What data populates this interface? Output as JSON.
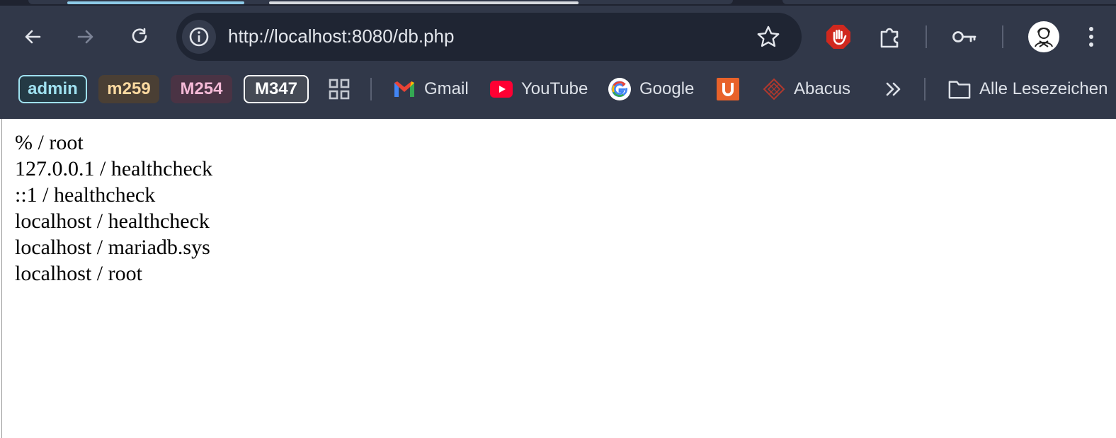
{
  "toolbar": {
    "url": "http://localhost:8080/db.php"
  },
  "bookmarks": {
    "group_chips": [
      {
        "label": "admin",
        "color": "#9fe1f0"
      },
      {
        "label": "m259",
        "color": "#fbd9a0"
      },
      {
        "label": "M254",
        "color": "#f4b9d6"
      },
      {
        "label": "M347",
        "color": "#ffffff"
      }
    ],
    "links": [
      {
        "label": "Gmail",
        "icon": "gmail-icon"
      },
      {
        "label": "YouTube",
        "icon": "youtube-icon"
      },
      {
        "label": "Google",
        "icon": "google-icon"
      },
      {
        "label": "Abacus",
        "icon": "abacus-icon"
      }
    ],
    "unlabeled_icon": "u-app-icon",
    "all_bookmarks_label": "Alle Lesezeichen"
  },
  "page": {
    "lines": [
      "% / root",
      "127.0.0.1 / healthcheck",
      "::1 / healthcheck",
      "localhost / healthcheck",
      "localhost / mariadb.sys",
      "localhost / root"
    ]
  },
  "colors": {
    "chrome_bg": "#313849",
    "omnibox_bg": "#1f2533",
    "tab_indicator": "#8ecbe8"
  }
}
